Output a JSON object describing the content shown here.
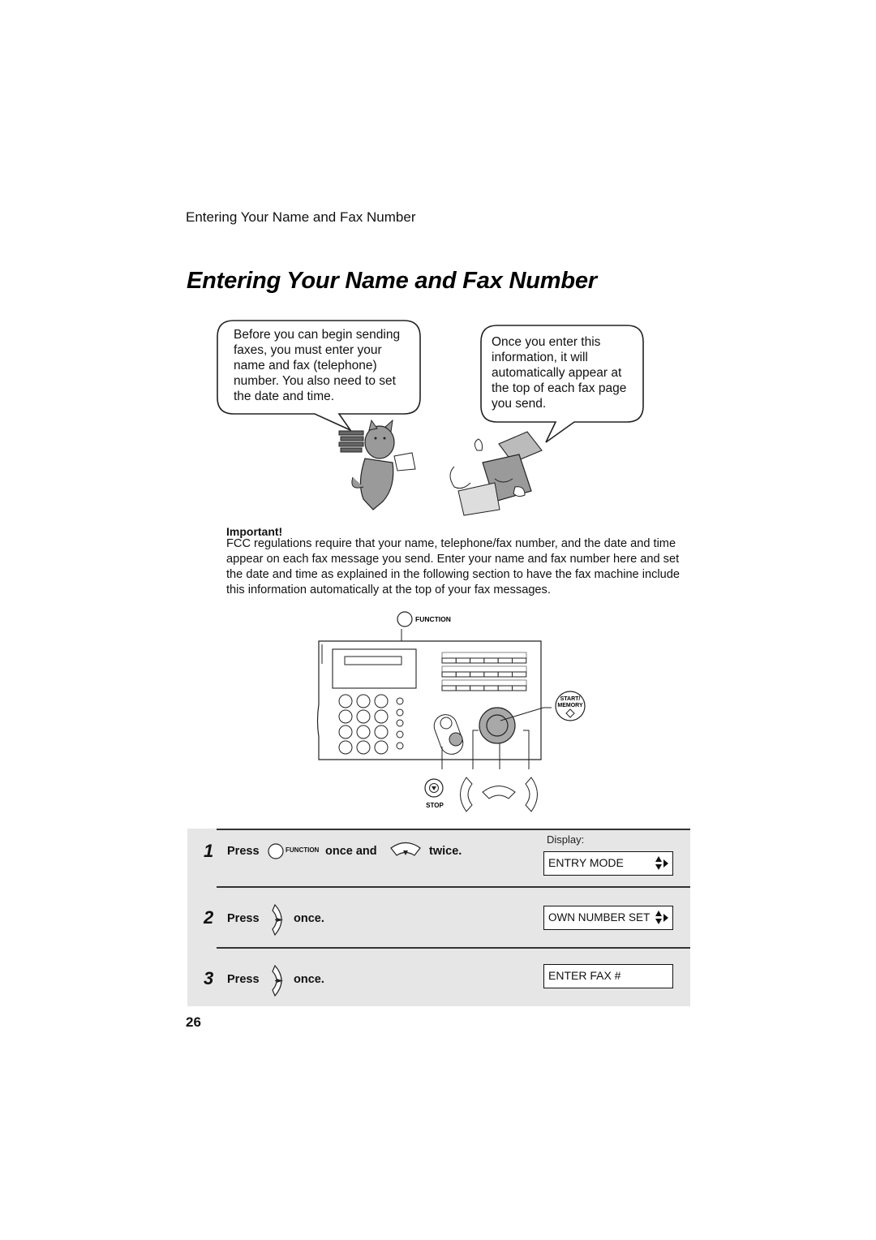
{
  "header": {
    "running_head": "Entering Your Name and Fax Number",
    "page_title": "Entering Your Name and Fax Number"
  },
  "illustration": {
    "left_bubble": {
      "lines": [
        "Before you can begin sending",
        "faxes, you must enter your",
        "name and fax (telephone)",
        "number. You also need to set",
        "the date and time."
      ]
    },
    "right_bubble": {
      "lines": [
        "Once you enter this",
        "information, it will",
        "automatically appear at",
        "the top of each fax page",
        "you send."
      ]
    },
    "characters": [
      "dog-mascot-with-books",
      "fax-machine-mascot"
    ]
  },
  "important": {
    "label": "Important!",
    "body": "FCC regulations require that your name, telephone/fax number, and the date and time appear on each fax message you send. Enter your name and fax number here and set the date and time as explained in the following section to have the fax machine include this information automatically at the top of your fax messages."
  },
  "panel_diagram": {
    "function_label": "FUNCTION",
    "start_memory_label": "START/\nMEMORY",
    "start_label": "START/",
    "memory_label": "MEMORY",
    "stop_label": "STOP"
  },
  "steps": {
    "display_label": "Display:",
    "items": [
      {
        "number": "1",
        "press": "Press",
        "function_label": "FUNCTION",
        "middle": "once and",
        "end": "twice.",
        "display": "ENTRY MODE",
        "display_arrows": true
      },
      {
        "number": "2",
        "press": "Press",
        "end": "once.",
        "display": "OWN NUMBER SET",
        "display_arrows": true
      },
      {
        "number": "3",
        "press": "Press",
        "end": "once.",
        "display": "ENTER FAX #",
        "display_arrows": false
      }
    ]
  },
  "footer": {
    "page_number": "26"
  },
  "colors": {
    "steps_background": "#e6e6e6",
    "mascot_gray": "#9a9a9a",
    "panel_button_gray": "#a8a8a8"
  }
}
